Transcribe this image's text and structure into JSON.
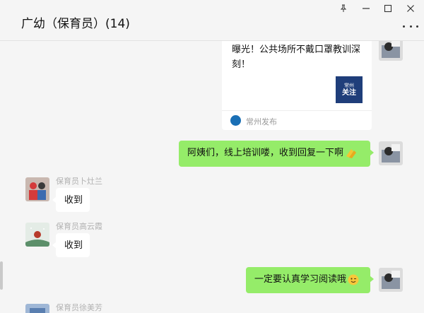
{
  "window": {
    "title": "广幼（保育员）(14)",
    "controls": {
      "pin": "pin-icon",
      "minimize": "minimize-icon",
      "maximize": "maximize-icon",
      "close": "close-icon"
    },
    "more_menu": "more-icon"
  },
  "messages": [
    {
      "type": "article-card",
      "side": "right",
      "title": "曝光！公共场所不戴口罩教训深刻！",
      "thumb_small_text": "常州",
      "thumb_text": "关注",
      "source": "常州发布"
    },
    {
      "type": "text",
      "side": "right",
      "text": "阿姨们，线上培训喽，收到回复一下啊",
      "emoji": "clap-emoji"
    },
    {
      "type": "text",
      "side": "left",
      "sender": "保育员卜灶兰",
      "text": "收到"
    },
    {
      "type": "text",
      "side": "left",
      "sender": "保育员高云霞",
      "text": "收到"
    },
    {
      "type": "text",
      "side": "right",
      "text": "一定要认真学习阅读哦",
      "emoji": "wink-emoji"
    },
    {
      "type": "text",
      "side": "left",
      "sender": "保育员徐美芳",
      "text": ""
    }
  ],
  "colors": {
    "bubble_self": "#95ec69",
    "bubble_other": "#ffffff",
    "background": "#f5f5f5",
    "name_text": "#b2b2b2"
  }
}
